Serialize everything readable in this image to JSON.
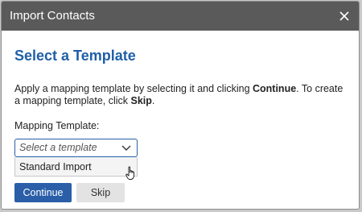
{
  "dialog": {
    "title": "Import Contacts",
    "heading": "Select a Template",
    "description": {
      "part1": "Apply a mapping template by selecting it and clicking ",
      "bold1": "Continue",
      "part2": ". To create a mapping template, click ",
      "bold2": "Skip",
      "part3": "."
    },
    "field_label": "Mapping Template:",
    "select": {
      "placeholder": "Select a template",
      "options": [
        "Standard Import"
      ]
    },
    "buttons": {
      "continue": "Continue",
      "skip": "Skip"
    }
  },
  "icons": {
    "close": "close-icon",
    "chevron": "chevron-down-icon",
    "cursor": "hand-pointer-cursor"
  },
  "colors": {
    "titlebar": "#5a5a5a",
    "accent": "#1f5fa8",
    "primary_button": "#2a5ea8",
    "secondary_button": "#e3e3e3"
  }
}
